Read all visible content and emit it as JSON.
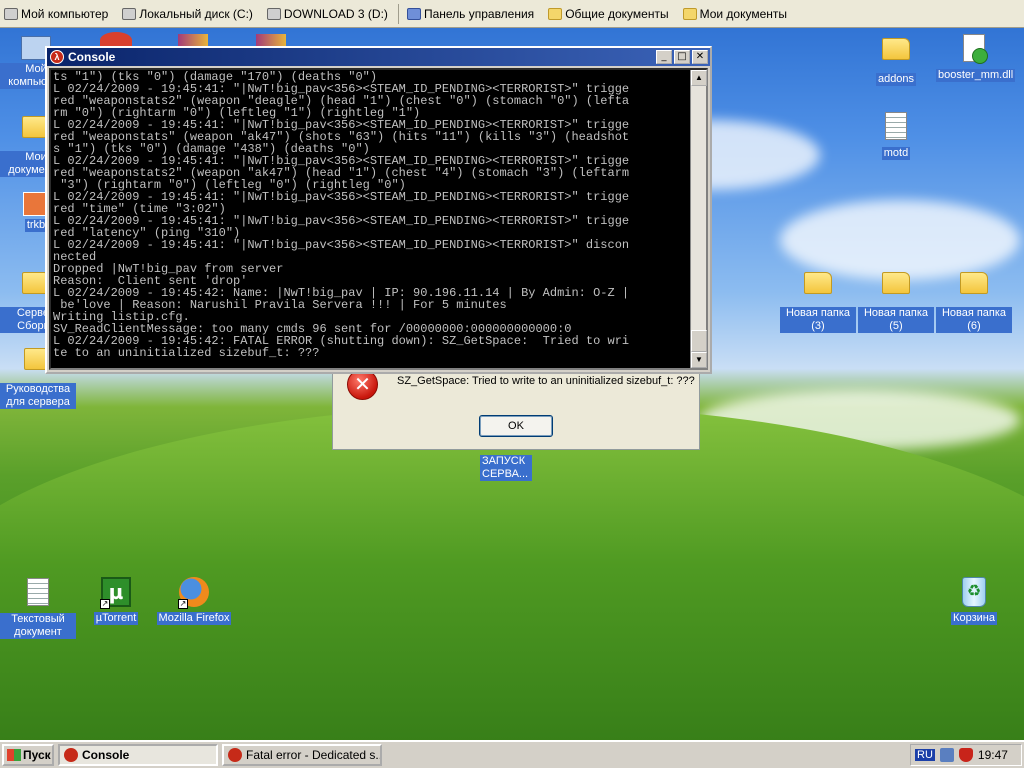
{
  "topbar": {
    "items": [
      {
        "icon": "computer-icon",
        "label": "Мой компьютер"
      },
      {
        "icon": "disk-icon",
        "label": "Локальный диск (C:)"
      },
      {
        "icon": "disk-icon",
        "label": "DOWNLOAD 3 (D:)"
      },
      {
        "icon": "control-panel-icon",
        "label": "Панель управления"
      },
      {
        "icon": "folder-icon",
        "label": "Общие документы"
      },
      {
        "icon": "folder-icon",
        "label": "Мои документы"
      }
    ]
  },
  "desktop": {
    "left_icons": [
      {
        "label": "Мой компьютер"
      },
      {
        "label": "Мои документы"
      },
      {
        "label": "trkb"
      },
      {
        "label": "Сервер Сборка"
      },
      {
        "label": "Руководства для сервера"
      }
    ],
    "right_icons": [
      {
        "label": "addons"
      },
      {
        "label": "booster_mm.dll"
      },
      {
        "label": "motd"
      },
      {
        "label": "Новая папка (3)"
      },
      {
        "label": "Новая папка (5)"
      },
      {
        "label": "Новая папка (6)"
      },
      {
        "label": "ЗАПУСК СЕРВА..."
      }
    ],
    "bottom_icons": [
      {
        "label": "Текстовый документ"
      },
      {
        "label": "µTorrent"
      },
      {
        "label": "Mozilla Firefox"
      },
      {
        "label": "Корзина"
      }
    ]
  },
  "error_dialog": {
    "message": "SZ_GetSpace:  Tried to write to an uninitialized sizebuf_t: ???",
    "ok_label": "OK"
  },
  "console": {
    "title": "Console",
    "lines": [
      "ts \"1\") (tks \"0\") (damage \"170\") (deaths \"0\")",
      "L 02/24/2009 - 19:45:41: \"|NwT!big_pav<356><STEAM_ID_PENDING><TERRORIST>\" trigge",
      "red \"weaponstats2\" (weapon \"deagle\") (head \"1\") (chest \"0\") (stomach \"0\") (lefta",
      "rm \"0\") (rightarm \"0\") (leftleg \"1\") (rightleg \"1\")",
      "L 02/24/2009 - 19:45:41: \"|NwT!big_pav<356><STEAM_ID_PENDING><TERRORIST>\" trigge",
      "red \"weaponstats\" (weapon \"ak47\") (shots \"63\") (hits \"11\") (kills \"3\") (headshot",
      "s \"1\") (tks \"0\") (damage \"438\") (deaths \"0\")",
      "L 02/24/2009 - 19:45:41: \"|NwT!big_pav<356><STEAM_ID_PENDING><TERRORIST>\" trigge",
      "red \"weaponstats2\" (weapon \"ak47\") (head \"1\") (chest \"4\") (stomach \"3\") (leftarm",
      " \"3\") (rightarm \"0\") (leftleg \"0\") (rightleg \"0\")",
      "L 02/24/2009 - 19:45:41: \"|NwT!big_pav<356><STEAM_ID_PENDING><TERRORIST>\" trigge",
      "red \"time\" (time \"3:02\")",
      "L 02/24/2009 - 19:45:41: \"|NwT!big_pav<356><STEAM_ID_PENDING><TERRORIST>\" trigge",
      "red \"latency\" (ping \"310\")",
      "L 02/24/2009 - 19:45:41: \"|NwT!big_pav<356><STEAM_ID_PENDING><TERRORIST>\" discon",
      "nected",
      "Dropped |NwT!big_pav from server",
      "Reason:  Client sent 'drop'",
      "L 02/24/2009 - 19:45:42: Name: |NwT!big_pav | IP: 90.196.11.14 | By Admin: O-Z |",
      " be'love | Reason: Narushil Pravila Servera !!! | For 5 minutes",
      "Writing listip.cfg.",
      "SV_ReadClientMessage: too many cmds 96 sent for /00000000:000000000000:0",
      "L 02/24/2009 - 19:45:42: FATAL ERROR (shutting down): SZ_GetSpace:  Tried to wri",
      "te to an uninitialized sizebuf_t: ???"
    ]
  },
  "taskbar": {
    "start_label": "Пуск",
    "tasks": [
      {
        "label": "Console",
        "active": true
      },
      {
        "label": "Fatal error - Dedicated s...",
        "active": false
      }
    ],
    "language": "RU",
    "clock": "19:47"
  }
}
